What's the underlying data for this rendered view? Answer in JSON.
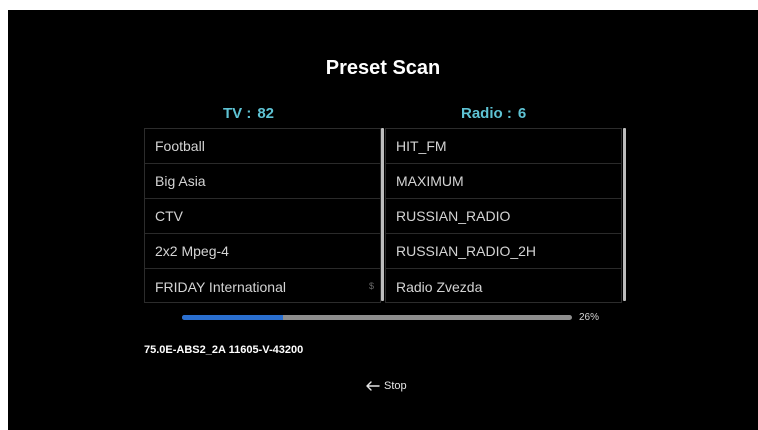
{
  "title": "Preset Scan",
  "tv": {
    "label": "TV :",
    "count": "82",
    "channels": [
      "Football",
      "Big Asia",
      "CTV",
      "2x2 Mpeg-4",
      "FRIDAY International"
    ],
    "scroll_mark": "$"
  },
  "radio": {
    "label": "Radio :",
    "count": "6",
    "channels": [
      "HIT_FM",
      "MAXIMUM",
      "RUSSIAN_RADIO",
      "RUSSIAN_RADIO_2H",
      "Radio Zvezda"
    ]
  },
  "progress": {
    "value": 0.26,
    "label": "26%"
  },
  "transponder": "75.0E-ABS2_2A 11605-V-43200",
  "stop": {
    "icon": "arrow-left-icon",
    "label": "Stop"
  },
  "colors": {
    "background": "#000000",
    "header_accent": "#5ec3d4",
    "progress_fill": "#2a6fd0",
    "progress_track": "#8e8e8e"
  }
}
